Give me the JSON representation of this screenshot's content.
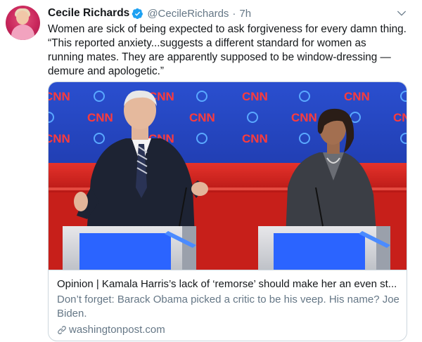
{
  "tweet": {
    "author_name": "Cecile Richards",
    "author_handle": "@CecileRichards",
    "separator": "·",
    "timestamp": "7h",
    "text_lines": [
      "Women are sick of being expected to ask forgiveness for every damn thing.",
      "“This reported anxiety...suggests a different standard for women as",
      "running mates. They are apparently supposed to be window-dressing —",
      "demure and apologetic.”"
    ]
  },
  "card": {
    "title": "Opinion | Kamala Harris’s lack of ‘remorse’ should make her an even st...",
    "description": "Don’t forget: Barack Obama picked a critic to be his veep. His name? Joe Biden.",
    "domain": "washingtonpost.com",
    "image_logo_text": "CNN"
  },
  "colors": {
    "verified_blue": "#1da1f2",
    "stage_blue": "#1d3fb3",
    "stage_red": "#d8231f",
    "secondary_text": "#657786"
  },
  "icons": {
    "verified": "verified-badge-icon",
    "caret": "chevron-down-icon",
    "link": "link-icon"
  }
}
